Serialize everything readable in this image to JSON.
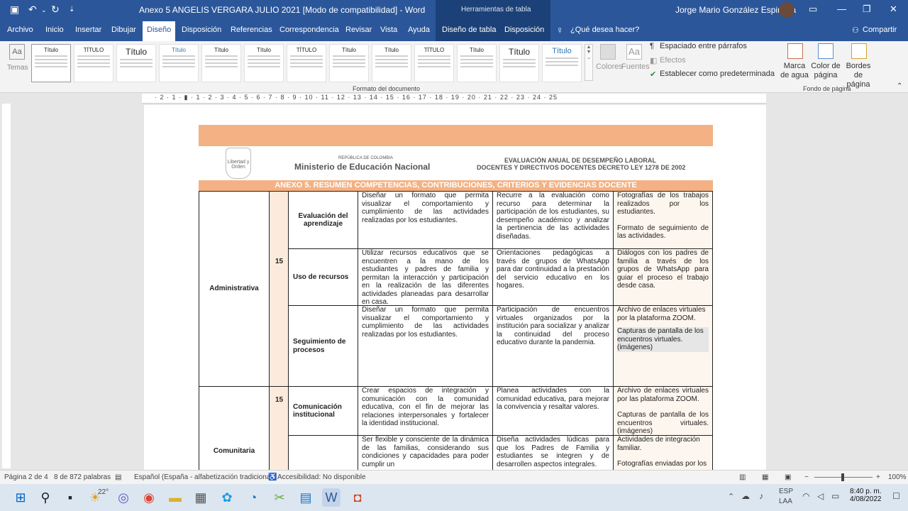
{
  "window": {
    "title": "Anexo 5 ANGELIS VERGARA JULIO 2021 [Modo de compatibilidad] - Word",
    "contextual_group": "Herramientas de tabla",
    "user": "Jorge Mario González Espinosa"
  },
  "menu": {
    "items": [
      "Archivo",
      "Inicio",
      "Insertar",
      "Dibujar",
      "Diseño",
      "Disposición",
      "Referencias",
      "Correspondencia",
      "Revisar",
      "Vista",
      "Ayuda",
      "Diseño de tabla",
      "Disposición"
    ],
    "active": "Diseño",
    "tell_me": "¿Qué desea hacer?",
    "share": "Compartir"
  },
  "ribbon": {
    "temas": "Temas",
    "gallery_titles": [
      "Título",
      "TÍTULO",
      "Título",
      "Título",
      "Título",
      "Título",
      "TÍTULO",
      "Título",
      "Título",
      "TÍTULO",
      "Título",
      "Título",
      "Título",
      "Título"
    ],
    "group_formato": "Formato del documento",
    "colores": "Colores",
    "fuentes": "Fuentes",
    "espaciado": "Espaciado entre párrafos",
    "efectos": "Efectos",
    "predeterminada": "Establecer como predeterminada",
    "marca_agua": "Marca de agua",
    "color_pagina": "Color de página",
    "bordes_pagina": "Bordes de página",
    "group_fondo": "Fondo de página"
  },
  "ruler": "· 2 · 1 · ▮ · 1 · 2 · 3 · 4 · 5 · 6 · 7 · 8 · 9 · 10 · 11 · 12 · 13 · 14 · 15 · 16 · 17 · 18 · 19 · 20 · 21 · 22 · 23 · 24 · 25",
  "document": {
    "header": {
      "republica": "REPÚBLICA DE COLOMBIA",
      "ministerio": "Ministerio de Educación Nacional",
      "eval_line1": "EVALUACIÓN ANUAL DE DESEMPEÑO LABORAL",
      "eval_line2": "DOCENTES Y DIRECTIVOS DOCENTES DECRETO LEY 1278 DE 2002",
      "logo_caption": "Libertad y Orden",
      "anexo_title": "ANEXO 5. RESUMEN COMPETENCIAS, CONTRIBUCIONES, CRITERIOS Y EVIDENCIAS DOCENTE"
    },
    "table": {
      "areas": [
        "Administrativa",
        "Comunitaria"
      ],
      "weights": [
        "15",
        "15"
      ],
      "rows": [
        {
          "competencia": "Evaluación del aprendizaje",
          "contribucion": "Diseñar un formato que permita visualizar el comportamiento y cumplimiento de las actividades realizadas por los estudiantes.",
          "criterio": "Recurre a la evaluación como recurso para determinar la participación de los estudiantes, su desempeño académico y analizar la pertinencia de las actividades diseñadas.",
          "evidencia1": "Fotografías de los trabajos realizados por los estudiantes.",
          "evidencia2": "Formato de seguimiento de las actividades."
        },
        {
          "competencia": "Uso de recursos",
          "contribucion": "Utilizar recursos educativos que se encuentren a la mano de los estudiantes y padres de familia y permitan la interacción y participación en la realización de las diferentes actividades planeadas para desarrollar en casa.",
          "criterio": "Orientaciones pedagógicas a través de grupos de WhatsApp para dar continuidad a la prestación del servicio educativo en los hogares.",
          "evidencia1": "Diálogos con los padres de familia a través de los grupos de WhatsApp para guiar el proceso el trabajo desde casa.",
          "evidencia2": ""
        },
        {
          "competencia": "Seguimiento de procesos",
          "contribucion": "Diseñar un formato que permita visualizar el comportamiento y cumplimiento de las actividades realizadas por los estudiantes.",
          "criterio": "Participación de encuentros virtuales organizados por la institución para socializar y analizar la continuidad del proceso educativo durante la pandemia.",
          "evidencia1": "Archivo de enlaces virtuales por la plataforma ZOOM.",
          "evidencia2": "Capturas de pantalla de los encuentros virtuales. (imágenes)"
        },
        {
          "competencia": "Comunicación institucional",
          "contribucion": "Crear espacios de integración y comunicación con la comunidad educativa, con el fin de mejorar las relaciones interpersonales y fortalecer la identidad institucional.",
          "criterio": "Planea actividades con la comunidad educativa, para mejorar la convivencia y resaltar valores.",
          "evidencia1": "Archivo de enlaces virtuales por las plataforma ZOOM.",
          "evidencia2": "Capturas de pantalla de los encuentros virtuales. (imágenes)"
        },
        {
          "competencia": "",
          "contribucion": "Ser flexible y consciente de la dinámica de las familias, considerando sus condiciones y capacidades para poder cumplir un",
          "criterio": "Diseña actividades lúdicas para que los Padres de Familia y estudiantes se integren y de desarrollen aspectos integrales.",
          "evidencia1": "Actividades de integración familiar.",
          "evidencia2": "Fotografías enviadas por los"
        }
      ]
    }
  },
  "status": {
    "page": "Página 2 de 4",
    "words": "8 de 872 palabras",
    "language": "Español (España - alfabetización tradicional)",
    "accessibility": "Accesibilidad: No disponible",
    "zoom": "100%"
  },
  "taskbar": {
    "weather": "22°",
    "lang1": "ESP",
    "lang2": "LAA",
    "time": "8:40 p. m.",
    "date": "4/08/2022"
  }
}
